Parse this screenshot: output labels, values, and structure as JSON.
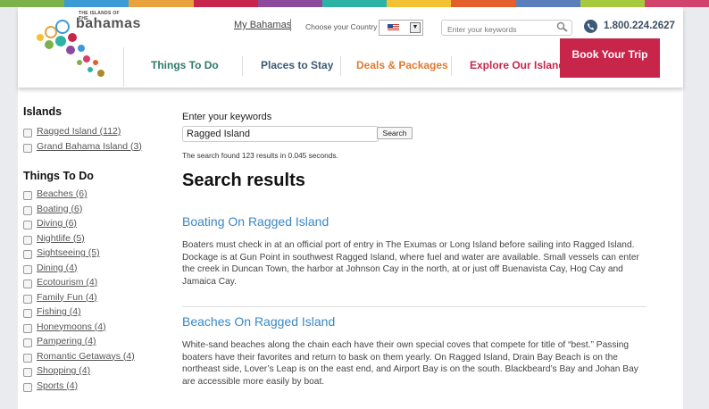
{
  "topbar_colors": [
    "#7bb34a",
    "#3a9bd5",
    "#e8a33c",
    "#c8254b",
    "#8c4a9c",
    "#2db3a6",
    "#f2c232",
    "#e45f2b",
    "#5b7fbd",
    "#a7c93d",
    "#d1436c"
  ],
  "logo": {
    "small": "THE ISLANDS OF THE",
    "word": "bahamas"
  },
  "utility": {
    "my_bahamas": "My Bahamas",
    "choose_country": "Choose your Country",
    "keywords_placeholder": "Enter your keywords",
    "phone": "1.800.224.2627"
  },
  "nav": {
    "items": [
      {
        "label": "Things To Do",
        "color": "#2e7a6a"
      },
      {
        "label": "Places to Stay",
        "color": "#3c5a75"
      },
      {
        "label": "Deals & Packages",
        "color": "#e07a2f"
      },
      {
        "label": "Explore Our Islands",
        "color": "#c8254b"
      }
    ],
    "book": "Book Your Trip"
  },
  "sidebar": {
    "islands_heading": "Islands",
    "islands": [
      "Ragged Island (112)",
      "Grand Bahama Island (3)"
    ],
    "things_heading": "Things To Do",
    "things": [
      "Beaches (6)",
      "Boating (6)",
      "Diving (6)",
      "Nightlife (5)",
      "Sightseeing (5)",
      "Dining (4)",
      "Ecotourism (4)",
      "Family Fun (4)",
      "Fishing (4)",
      "Honeymoons (4)",
      "Pampering (4)",
      "Romantic Getaways (4)",
      "Shopping (4)",
      "Sports (4)"
    ]
  },
  "search": {
    "label": "Enter your keywords",
    "value": "Ragged Island",
    "button": "Search",
    "found": "The search found 123 results in 0.045 seconds.",
    "heading": "Search results"
  },
  "results": [
    {
      "title": "Boating On Ragged Island",
      "text": "Boaters must check in at an official port of entry in The Exumas or Long Island before sailing into Ragged Island. Dockage is at Gun Point in southwest Ragged Island, where fuel and water are available. Small vessels can enter the creek in Duncan Town, the harbor at Johnson Cay in the north, at or just off Buenavista Cay, Hog Cay and Jamaica Cay."
    },
    {
      "title": "Beaches On Ragged Island",
      "text": "White-sand beaches along the chain each have their own special coves that compete for title of “best.” Passing boaters have their favorites and return to bask on them yearly. On Ragged Island, Drain Bay Beach is on the northeast side, Lover’s Leap is on the east end, and Airport Bay is on the south. Blackbeard’s Bay and Johan Bay are accessible more easily by boat."
    }
  ]
}
